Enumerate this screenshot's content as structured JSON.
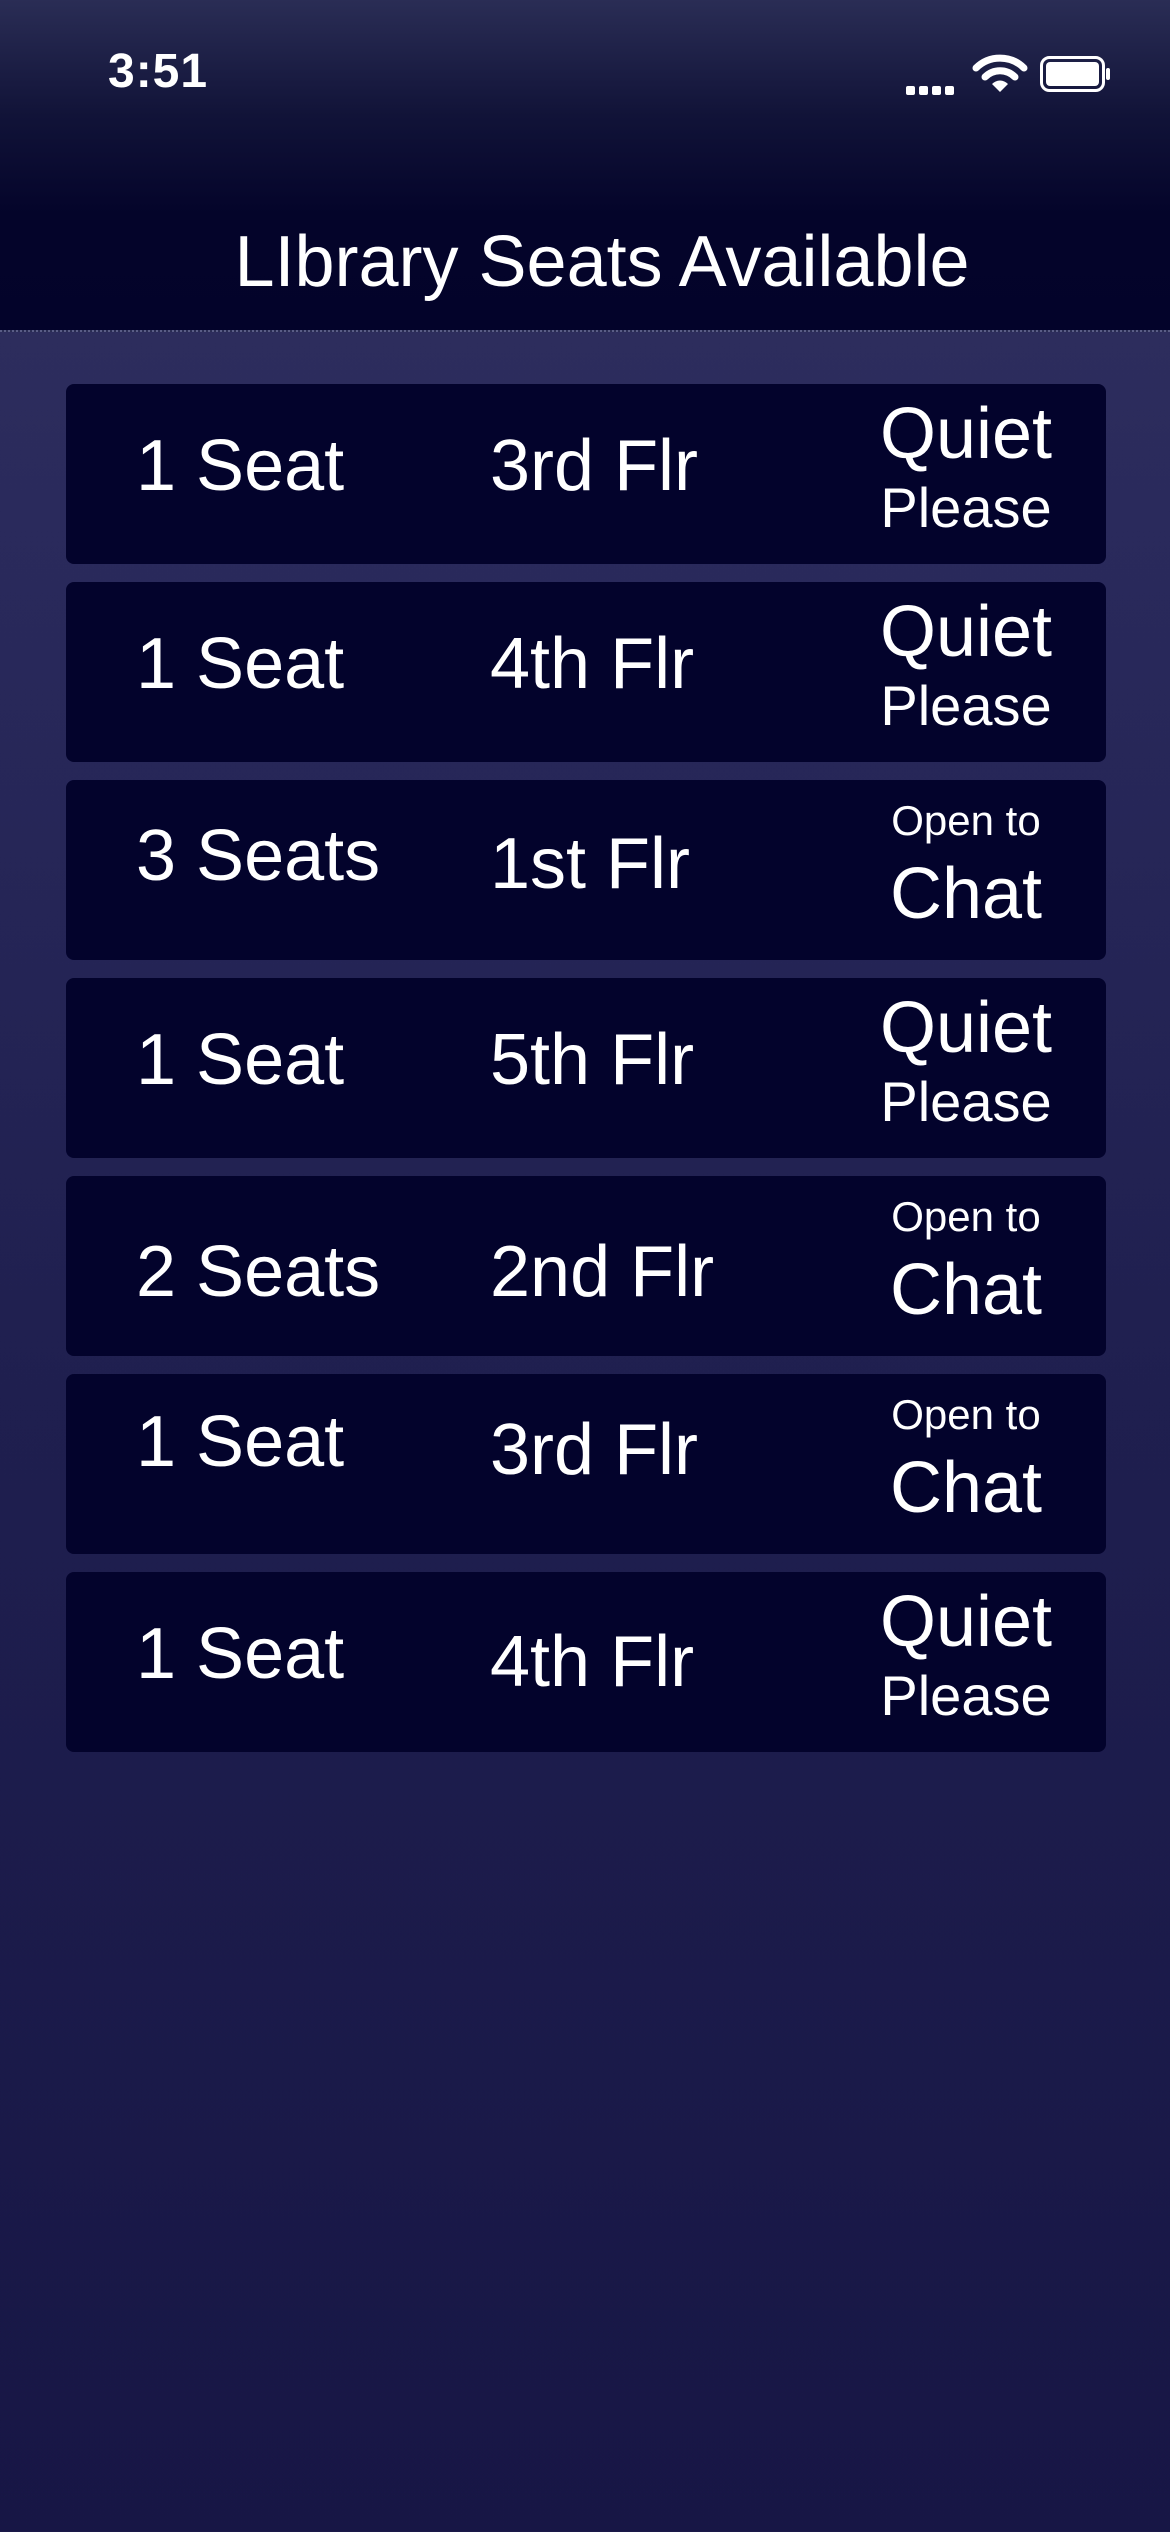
{
  "status_bar": {
    "time": "3:51"
  },
  "header": {
    "title": "LIbrary Seats Available"
  },
  "seats": [
    {
      "count": "1 Seat",
      "floor": "3rd Flr",
      "noise_main": "Quiet",
      "noise_sub": "Please",
      "noise_type": "quiet"
    },
    {
      "count": "1 Seat",
      "floor": "4th Flr",
      "noise_main": "Quiet",
      "noise_sub": "Please",
      "noise_type": "quiet"
    },
    {
      "count": "3 Seats",
      "floor": "1st Flr",
      "noise_main": "Chat",
      "noise_sub": "Open to",
      "noise_type": "chat"
    },
    {
      "count": "1 Seat",
      "floor": "5th Flr",
      "noise_main": "Quiet",
      "noise_sub": "Please",
      "noise_type": "quiet"
    },
    {
      "count": "2 Seats",
      "floor": "2nd Flr",
      "noise_main": "Chat",
      "noise_sub": "Open to",
      "noise_type": "chat"
    },
    {
      "count": "1 Seat",
      "floor": "3rd Flr",
      "noise_main": "Chat",
      "noise_sub": "Open to",
      "noise_type": "chat"
    },
    {
      "count": "1 Seat",
      "floor": "4th Flr",
      "noise_main": "Quiet",
      "noise_sub": "Please",
      "noise_type": "quiet"
    }
  ],
  "colors": {
    "card_background": "#03032c",
    "header_background": "#03032a",
    "page_background_top": "#33335f",
    "page_background_bottom": "#171645",
    "text": "#ffffff"
  },
  "icons": [
    "cellular-signal-icon",
    "wifi-icon",
    "battery-icon"
  ]
}
